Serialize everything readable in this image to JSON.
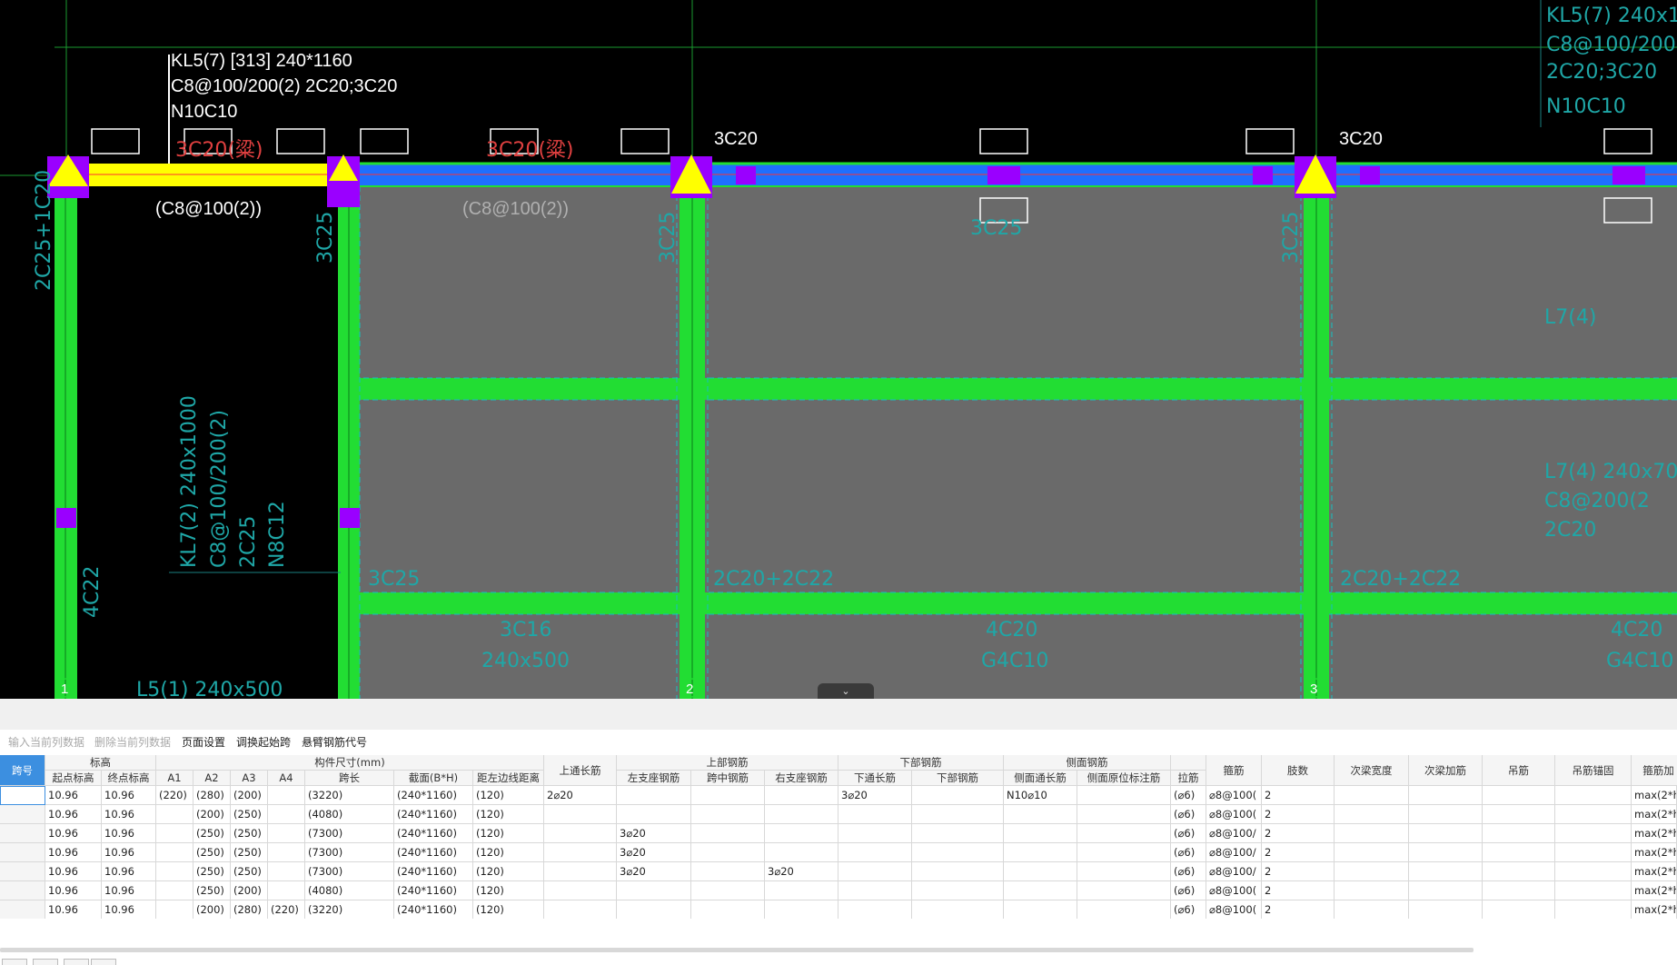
{
  "cad": {
    "beam_label": [
      "KL5(7) [313] 240*1160",
      "C8@100/200(2) 2C20;3C20",
      "N10C10"
    ],
    "stirrup_span1": "(C8@100(2))",
    "stirrup_span2": "(C8@100(2))",
    "top_left_support_1": "3C20",
    "top_left_support_2": "3C20",
    "faint_red_1": "3C20(粱)",
    "faint_red_2": "3C20(粱)",
    "faint_cyan_top_right": [
      "KL5(7) 240x116",
      "C8@100/200(2",
      "2C20;3C20",
      "N10C10"
    ],
    "faint_col1": "2C25+1C20",
    "faint_col2": "3C25",
    "faint_col3": "3C25",
    "faint_col4": "3C25",
    "faint_kl7": [
      "KL7(2) 240x1000",
      "C8@100/200(2)",
      "2C25",
      "N8C12"
    ],
    "faint_4c22": "4C22",
    "faint_l5": "L5(1) 240x500",
    "faint_l7a": "L7(4)",
    "faint_l7b": [
      "L7(4) 240x70",
      "C8@200(2",
      "2C20"
    ],
    "faint_mid1": "2C20+2C22",
    "faint_mid2": "2C20+2C22",
    "faint_bot1": [
      "3C16",
      "240x500"
    ],
    "faint_bot2": [
      "4C20",
      "G4C10"
    ],
    "faint_bot3": [
      "4C20",
      "G4C10"
    ],
    "axis_labels": [
      "1",
      "2",
      "3"
    ],
    "colors": {
      "beam_highlight": "#ffff00",
      "beam_blue": "#1e6fff",
      "green": "#22dd33",
      "purple": "#9a00ff",
      "slab": "#6a6a6a"
    }
  },
  "collapse_icon": "chevron-down-icon",
  "toolbar": {
    "input_column": "输入当前列数据",
    "delete_column": "删除当前列数据",
    "page_setup": "页面设置",
    "swap_start": "调换起始跨",
    "cantilever_code": "悬臂钢筋代号"
  },
  "table": {
    "group_headers": {
      "span_no": "跨号",
      "elevation": "标高",
      "component_size": "构件尺寸(mm)",
      "top_through": "上通长筋",
      "top_rebar": "上部钢筋",
      "bottom_rebar": "下部钢筋",
      "side_rebar": "侧面钢筋",
      "stirrup": "箍筋",
      "legs": "肢数",
      "secondary_width": "次梁宽度",
      "secondary_add": "次梁加筋",
      "hanger": "吊筋",
      "hanger_anchor": "吊筋锚固",
      "stirrup_add": "箍筋加"
    },
    "sub_headers": {
      "start_elev": "起点标高",
      "end_elev": "终点标高",
      "a1": "A1",
      "a2": "A2",
      "a3": "A3",
      "a4": "A4",
      "span_length": "跨长",
      "section": "截面(B*H)",
      "edge_dist": "距左边线距离",
      "left_support": "左支座钢筋",
      "mid_span": "跨中钢筋",
      "right_support": "右支座钢筋",
      "bottom_through": "下通长筋",
      "bottom": "下部钢筋",
      "side_through": "侧面通长筋",
      "side_annot": "侧面原位标注筋",
      "tie": "拉筋"
    },
    "rows": [
      {
        "no": "",
        "start": "10.96",
        "end": "10.96",
        "a1": "(220)",
        "a2": "(280)",
        "a3": "(200)",
        "a4": "",
        "span": "(3220)",
        "sec": "(240*1160)",
        "edge": "(120)",
        "top_through": "2⌀20",
        "left": "",
        "mid": "",
        "right": "",
        "bot_through": "3⌀20",
        "bot": "",
        "side_through": "N10⌀10",
        "side_annot": "",
        "tie": "(⌀6)",
        "stirrup": "⌀8@100(",
        "legs": "2",
        "sec_w": "",
        "sec_add": "",
        "hanger": "",
        "hanger_anchor": "",
        "stirrup_add": "max(2*h,"
      },
      {
        "no": "",
        "start": "10.96",
        "end": "10.96",
        "a1": "",
        "a2": "(200)",
        "a3": "(250)",
        "a4": "",
        "span": "(4080)",
        "sec": "(240*1160)",
        "edge": "(120)",
        "top_through": "",
        "left": "",
        "mid": "",
        "right": "",
        "bot_through": "",
        "bot": "",
        "side_through": "",
        "side_annot": "",
        "tie": "(⌀6)",
        "stirrup": "⌀8@100(",
        "legs": "2",
        "sec_w": "",
        "sec_add": "",
        "hanger": "",
        "hanger_anchor": "",
        "stirrup_add": "max(2*h,"
      },
      {
        "no": "",
        "start": "10.96",
        "end": "10.96",
        "a1": "",
        "a2": "(250)",
        "a3": "(250)",
        "a4": "",
        "span": "(7300)",
        "sec": "(240*1160)",
        "edge": "(120)",
        "top_through": "",
        "left": "3⌀20",
        "mid": "",
        "right": "",
        "bot_through": "",
        "bot": "",
        "side_through": "",
        "side_annot": "",
        "tie": "(⌀6)",
        "stirrup": "⌀8@100/",
        "legs": "2",
        "sec_w": "",
        "sec_add": "",
        "hanger": "",
        "hanger_anchor": "",
        "stirrup_add": "max(2*h,"
      },
      {
        "no": "",
        "start": "10.96",
        "end": "10.96",
        "a1": "",
        "a2": "(250)",
        "a3": "(250)",
        "a4": "",
        "span": "(7300)",
        "sec": "(240*1160)",
        "edge": "(120)",
        "top_through": "",
        "left": "3⌀20",
        "mid": "",
        "right": "",
        "bot_through": "",
        "bot": "",
        "side_through": "",
        "side_annot": "",
        "tie": "(⌀6)",
        "stirrup": "⌀8@100/",
        "legs": "2",
        "sec_w": "",
        "sec_add": "",
        "hanger": "",
        "hanger_anchor": "",
        "stirrup_add": "max(2*h,"
      },
      {
        "no": "",
        "start": "10.96",
        "end": "10.96",
        "a1": "",
        "a2": "(250)",
        "a3": "(250)",
        "a4": "",
        "span": "(7300)",
        "sec": "(240*1160)",
        "edge": "(120)",
        "top_through": "",
        "left": "3⌀20",
        "mid": "",
        "right": "3⌀20",
        "bot_through": "",
        "bot": "",
        "side_through": "",
        "side_annot": "",
        "tie": "(⌀6)",
        "stirrup": "⌀8@100/",
        "legs": "2",
        "sec_w": "",
        "sec_add": "",
        "hanger": "",
        "hanger_anchor": "",
        "stirrup_add": "max(2*h,"
      },
      {
        "no": "",
        "start": "10.96",
        "end": "10.96",
        "a1": "",
        "a2": "(250)",
        "a3": "(200)",
        "a4": "",
        "span": "(4080)",
        "sec": "(240*1160)",
        "edge": "(120)",
        "top_through": "",
        "left": "",
        "mid": "",
        "right": "",
        "bot_through": "",
        "bot": "",
        "side_through": "",
        "side_annot": "",
        "tie": "(⌀6)",
        "stirrup": "⌀8@100(",
        "legs": "2",
        "sec_w": "",
        "sec_add": "",
        "hanger": "",
        "hanger_anchor": "",
        "stirrup_add": "max(2*h,"
      },
      {
        "no": "",
        "start": "10.96",
        "end": "10.96",
        "a1": "",
        "a2": "(200)",
        "a3": "(280)",
        "a4": "(220)",
        "span": "(3220)",
        "sec": "(240*1160)",
        "edge": "(120)",
        "top_through": "",
        "left": "",
        "mid": "",
        "right": "",
        "bot_through": "",
        "bot": "",
        "side_through": "",
        "side_annot": "",
        "tie": "(⌀6)",
        "stirrup": "⌀8@100(",
        "legs": "2",
        "sec_w": "",
        "sec_add": "",
        "hanger": "",
        "hanger_anchor": "",
        "stirrup_add": "max(2*h,"
      }
    ]
  }
}
